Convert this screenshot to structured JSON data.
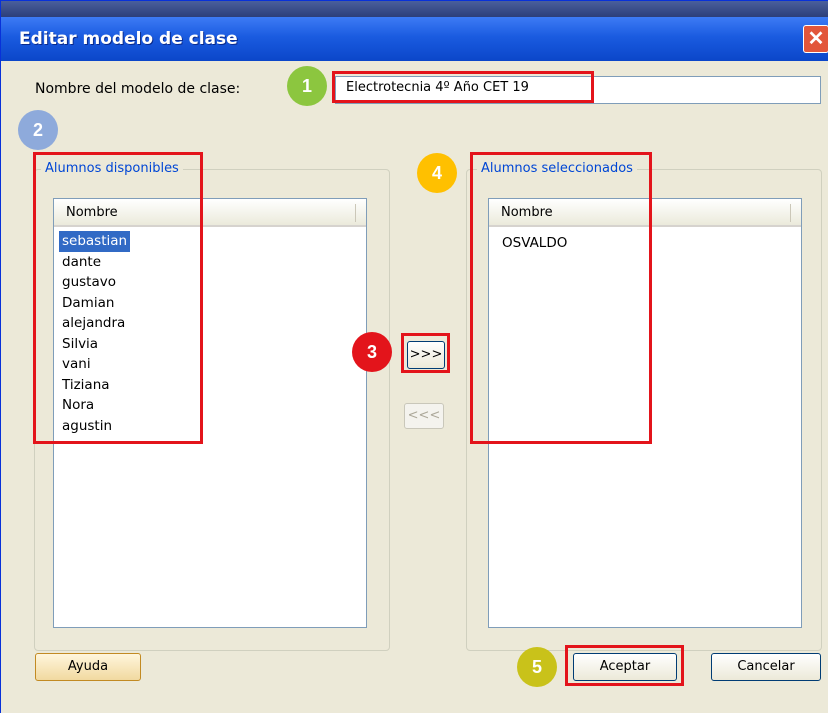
{
  "window": {
    "title": "Editar modelo de clase",
    "close_glyph": "✕"
  },
  "form": {
    "name_label": "Nombre del modelo de clase:",
    "name_value": "Electrotecnia 4º Año CET 19"
  },
  "available": {
    "group_title": "Alumnos disponibles",
    "column": "Nombre",
    "items": [
      "sebastian",
      "dante",
      "gustavo",
      "Damian",
      "alejandra",
      "Silvia",
      "vani",
      "Tiziana",
      "Nora",
      "agustin"
    ]
  },
  "selected": {
    "group_title": "Alumnos seleccionados",
    "column": "Nombre",
    "items": [
      "OSVALDO"
    ]
  },
  "buttons": {
    "add": ">>>",
    "remove": "<<<",
    "help": "Ayuda",
    "ok": "Aceptar",
    "cancel": "Cancelar"
  },
  "badges": [
    "1",
    "2",
    "3",
    "4",
    "5"
  ],
  "colors": {
    "highlight": "#e3141b",
    "title_bar": "#0b46c9",
    "selection": "#316ac5"
  },
  "icons": {
    "close": "close-icon"
  }
}
